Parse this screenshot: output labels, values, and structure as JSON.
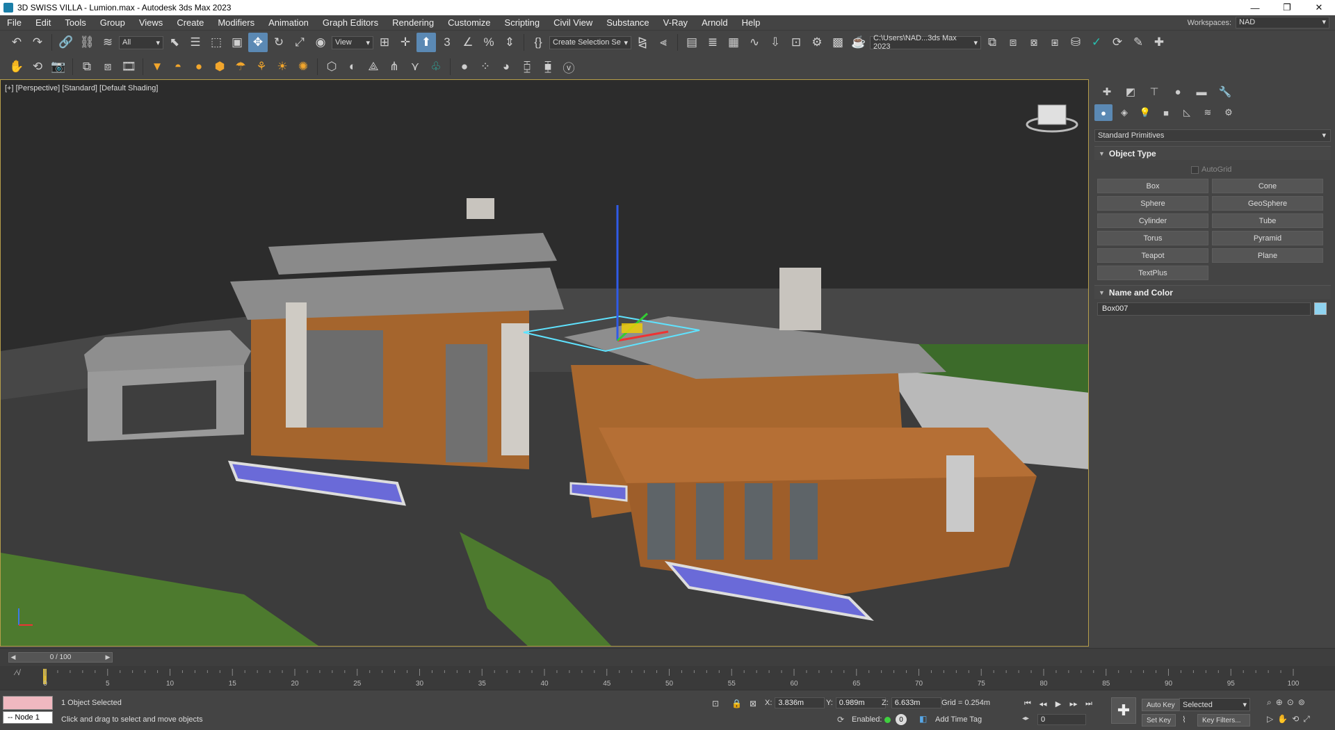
{
  "window": {
    "title": "3D SWISS VILLA - Lumion.max - Autodesk 3ds Max 2023",
    "minimize": "—",
    "maximize": "❐",
    "close": "✕"
  },
  "menu": [
    "File",
    "Edit",
    "Tools",
    "Group",
    "Views",
    "Create",
    "Modifiers",
    "Animation",
    "Graph Editors",
    "Rendering",
    "Customize",
    "Scripting",
    "Civil View",
    "Substance",
    "V-Ray",
    "Arnold",
    "Help"
  ],
  "workspaces": {
    "label": "Workspaces:",
    "value": "NAD"
  },
  "toolbar": {
    "selection_filter": "All",
    "ref_coord": "View",
    "named_selection": "Create Selection Se",
    "project_path": "C:\\Users\\NAD...3ds Max 2023"
  },
  "viewport": {
    "label": "[+] [Perspective] [Standard] [Default Shading]"
  },
  "command_panel": {
    "category": "Standard Primitives",
    "object_type": {
      "title": "Object Type",
      "autogrid": "AutoGrid",
      "buttons": [
        "Box",
        "Cone",
        "Sphere",
        "GeoSphere",
        "Cylinder",
        "Tube",
        "Torus",
        "Pyramid",
        "Teapot",
        "Plane",
        "TextPlus"
      ]
    },
    "name_and_color": {
      "title": "Name and Color",
      "name": "Box007",
      "color": "#8fd3f0"
    }
  },
  "time_slider": {
    "frame": "0 / 100"
  },
  "trackbar": {
    "ticks": [
      "0",
      "5",
      "10",
      "15",
      "20",
      "25",
      "30",
      "35",
      "40",
      "45",
      "50",
      "55",
      "60",
      "65",
      "70",
      "75",
      "80",
      "85",
      "90",
      "95",
      "100"
    ]
  },
  "status": {
    "maxscript_node": "-- Node 1",
    "selection": "1 Object Selected",
    "prompt": "Click and drag to select and move objects",
    "x_label": "X:",
    "x": "3.836m",
    "y_label": "Y:",
    "y": "0.989m",
    "z_label": "Z:",
    "z": "6.633m",
    "grid": "Grid = 0.254m",
    "enabled_label": "Enabled:",
    "enabled_value": "0",
    "add_time_tag": "Add Time Tag",
    "auto_key": "Auto Key",
    "set_key": "Set Key",
    "key_mode": "Selected",
    "key_filters": "Key Filters...",
    "current_frame": "0"
  }
}
